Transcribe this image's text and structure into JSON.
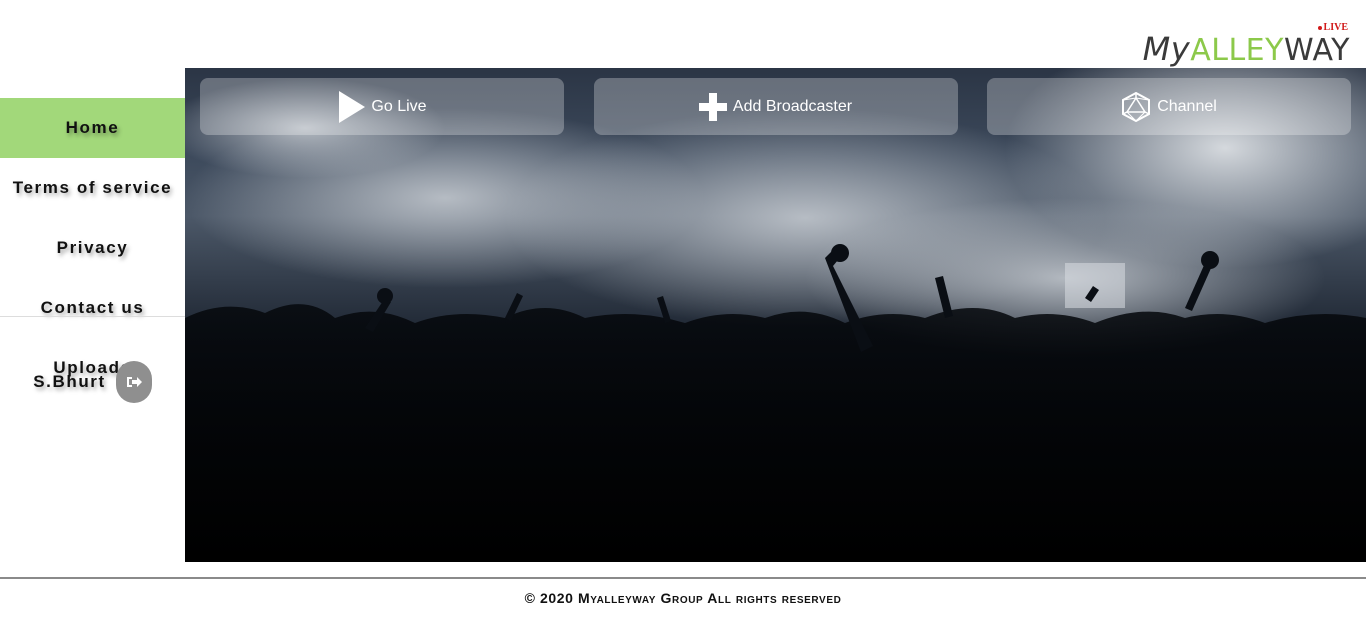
{
  "logo": {
    "my": "My",
    "alley": "ALLEY",
    "way": "WAY",
    "live": "LIVE"
  },
  "sidebar": {
    "items": [
      {
        "label": "Home",
        "active": true
      },
      {
        "label": "Terms of service",
        "active": false
      },
      {
        "label": "Privacy",
        "active": false
      },
      {
        "label": "Contact us",
        "active": false
      },
      {
        "label": "Uploads",
        "active": false
      }
    ],
    "user": {
      "name": "S.Bhurt",
      "logout_icon": "sign-out-icon"
    }
  },
  "hero": {
    "buttons": [
      {
        "label": "Go Live",
        "icon": "play-icon"
      },
      {
        "label": "Add Broadcaster",
        "icon": "plus-icon"
      },
      {
        "label": "Channel",
        "icon": "dice-icon"
      }
    ]
  },
  "footer": {
    "text": "© 2020 Myalleyway Group All rights reserved"
  },
  "colors": {
    "accent": "#a2d87a",
    "logo_green": "#8cc94a",
    "logo_red": "#d11a1a",
    "logout_bg": "#8f8f8f"
  }
}
